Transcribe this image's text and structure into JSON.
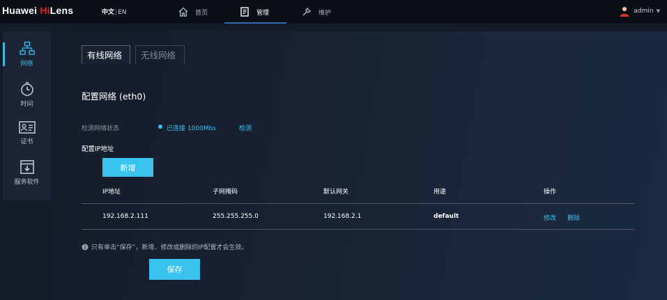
{
  "header": {
    "brand_part1": "Huawei ",
    "brand_highlight": "Hi",
    "brand_part2": "Lens",
    "lang_current": "中文",
    "lang_sep": "|",
    "lang_other": "EN",
    "nav": [
      {
        "label": "首页",
        "icon": "home-icon"
      },
      {
        "label": "管理",
        "icon": "document-icon"
      },
      {
        "label": "维护",
        "icon": "wrench-icon"
      }
    ],
    "active_nav": 1,
    "user": "admin",
    "user_icon": "user-avatar-icon"
  },
  "sidebar": {
    "items": [
      {
        "label": "网络",
        "icon": "network-icon"
      },
      {
        "label": "时间",
        "icon": "clock-icon"
      },
      {
        "label": "证书",
        "icon": "certificate-icon"
      },
      {
        "label": "服务软件",
        "icon": "download-box-icon"
      }
    ],
    "active": 0
  },
  "main": {
    "tabs": [
      "有线网络",
      "无线网络"
    ],
    "active_tab": 0,
    "section_title": "配置网络 (eth0)",
    "status_label": "检测网络状态",
    "status_text": "已连接 1000Mbs",
    "detect_link": "检测",
    "ip_label": "配置IP地址",
    "add_button": "新增",
    "table": {
      "headers": [
        "IP地址",
        "子网掩码",
        "默认网关",
        "用途",
        "操作"
      ],
      "rows": [
        {
          "ip": "192.168.2.111",
          "mask": "255.255.255.0",
          "gateway": "192.168.2.1",
          "usage": "default",
          "edit": "修改",
          "delete": "删除"
        }
      ]
    },
    "notice": "只有单击“保存”，新增、修改或删除的IP配置才会生效。",
    "save_button": "保存"
  },
  "colors": {
    "accent": "#39c3ee",
    "brand_red": "#e3242b",
    "topbar_bg": "#0b0f16",
    "panel_bg": "#1c2535"
  }
}
